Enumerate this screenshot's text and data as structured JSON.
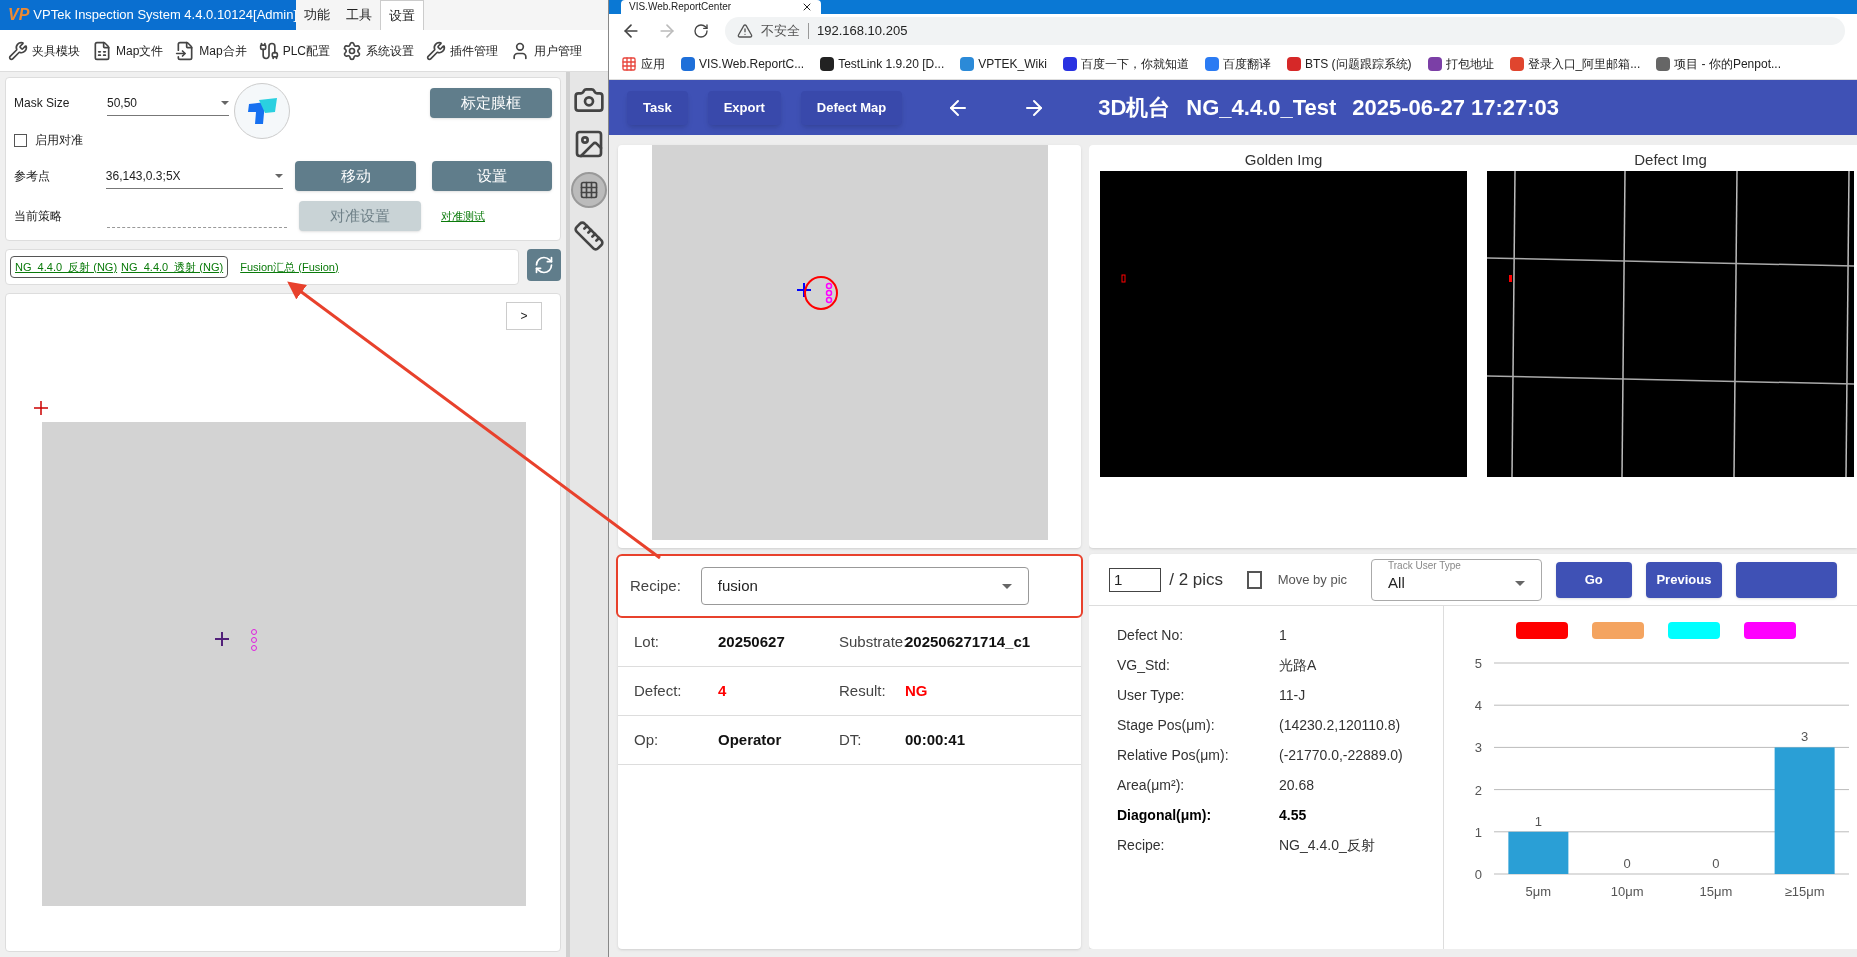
{
  "left_app": {
    "logo_text": "VP",
    "title": "VPTek Inspection System 4.4.0.10124[Admin]",
    "menu_tabs": [
      {
        "label": "功能",
        "selected": false
      },
      {
        "label": "工具",
        "selected": false
      },
      {
        "label": "设置",
        "selected": true
      }
    ],
    "toolbar": [
      {
        "kind": "fixture",
        "label": "夹具模块"
      },
      {
        "kind": "file",
        "label": "Map文件"
      },
      {
        "kind": "merge",
        "label": "Map合并"
      },
      {
        "kind": "plc",
        "label": "PLC配置"
      },
      {
        "kind": "gear",
        "label": "系统设置"
      },
      {
        "kind": "tools",
        "label": "插件管理"
      },
      {
        "kind": "user",
        "label": "用户管理"
      }
    ],
    "mask_size": {
      "label": "Mask Size",
      "value": "50,50"
    },
    "calibrate_button": {
      "label": "标定膜框",
      "disabled": false
    },
    "enable_alignment": {
      "label": "启用对准",
      "checked": false
    },
    "reference_point": {
      "label": "参考点",
      "value": "36,143,0.3;5X"
    },
    "move_button": {
      "label": "移动",
      "disabled": false
    },
    "settings_button": {
      "label": "设置",
      "disabled": false
    },
    "current_strategy": {
      "label": "当前策略"
    },
    "alignment_settings_button": {
      "label": "对准设置",
      "disabled": true
    },
    "alignment_test_link": "对准测试",
    "recipe_group": [
      {
        "label": "NG_4.4.0_反射 (NG)"
      },
      {
        "label": "NG_4.4.0_透射 (NG)"
      }
    ],
    "fusion_link": "Fusion汇总 (Fusion)",
    "canvas": {
      "expand_button": ">"
    }
  },
  "browser": {
    "tab_title": "VIS.Web.ReportCenter",
    "security": "不安全",
    "url": "192.168.10.205",
    "bookmarks": [
      {
        "kind": "apps",
        "label": "应用"
      },
      {
        "kind": "vis",
        "label": "VIS.Web.ReportC..."
      },
      {
        "kind": "testlink",
        "label": "TestLink 1.9.20 [D..."
      },
      {
        "kind": "wiki",
        "label": "VPTEK_Wiki"
      },
      {
        "kind": "baidu",
        "label": "百度一下，你就知道"
      },
      {
        "kind": "translate",
        "label": "百度翻译"
      },
      {
        "kind": "bts",
        "label": "BTS (问题跟踪系统)"
      },
      {
        "kind": "play",
        "label": "打包地址"
      },
      {
        "kind": "mail",
        "label": "登录入口_阿里邮箱..."
      },
      {
        "kind": "box",
        "label": "项目 - 你的Penpot..."
      }
    ],
    "header": {
      "buttons": [
        "Task",
        "Export",
        "Defect Map"
      ],
      "machine": "3D机台",
      "recipe": "NG_4.4.0_Test",
      "datetime": "2025-06-27 17:27:03"
    },
    "image_titles": [
      "Golden Img",
      "Defect Img"
    ],
    "recipe": {
      "label": "Recipe:",
      "value": "fusion"
    },
    "info_rows": [
      {
        "cells": [
          {
            "label": "Lot:",
            "value": "20250627",
            "alert": false
          },
          {
            "label": "Substrate:",
            "value": "202506271714_c1",
            "alert": false
          }
        ]
      },
      {
        "cells": [
          {
            "label": "Defect:",
            "value": "4",
            "alert": true
          },
          {
            "label": "Result:",
            "value": "NG",
            "alert": true
          }
        ]
      },
      {
        "cells": [
          {
            "label": "Op:",
            "value": "Operator",
            "alert": false
          },
          {
            "label": "DT:",
            "value": "00:00:41",
            "alert": false
          }
        ]
      }
    ],
    "pager": {
      "page": "1",
      "total": "/ 2 pics",
      "move_by_pic": {
        "label": "Move by pic",
        "checked": false
      },
      "track_user_type": {
        "label": "Track User Type",
        "value": "All"
      },
      "buttons": [
        "Go",
        "Previous"
      ]
    },
    "details": [
      {
        "label": "Defect No:",
        "value": "1",
        "bold": false
      },
      {
        "label": "VG_Std:",
        "value": "光路A",
        "bold": false
      },
      {
        "label": "User Type:",
        "value": "11-J",
        "bold": false
      },
      {
        "label": "Stage Pos(μm):",
        "value": "(14230.2,120110.8)",
        "bold": false
      },
      {
        "label": "Relative Pos(μm):",
        "value": "(-21770.0,-22889.0)",
        "bold": false
      },
      {
        "label": "Area(μm²):",
        "value": "20.68",
        "bold": false
      },
      {
        "label": "Diagonal(μm):",
        "value": "4.55",
        "bold": true
      },
      {
        "label": "Recipe:",
        "value": "NG_4.4.0_反射",
        "bold": false
      }
    ],
    "legend": [
      {
        "color": "#ff0000"
      },
      {
        "color": "#f4a460"
      },
      {
        "color": "#00ffff"
      },
      {
        "color": "#ff00ff"
      }
    ],
    "chart_data": {
      "type": "bar",
      "categories": [
        "5μm",
        "10μm",
        "15μm",
        "≥15μm"
      ],
      "series": [
        {
          "color": "#2a9fd6",
          "values": [
            1,
            0,
            0,
            3
          ]
        }
      ],
      "ylim": [
        0,
        5
      ],
      "yticks": [
        0,
        1,
        2,
        3,
        4,
        5
      ],
      "grid": true,
      "data_labels": true
    }
  }
}
